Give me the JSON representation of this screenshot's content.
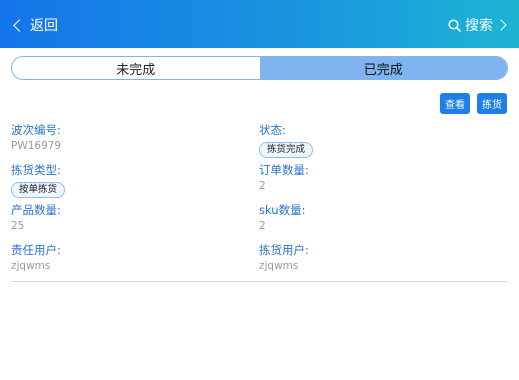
{
  "header": {
    "back_label": "返回",
    "search_label": "搜索"
  },
  "tabs": [
    {
      "label": "未完成",
      "active": false
    },
    {
      "label": "已完成",
      "active": true
    }
  ],
  "actions": {
    "view_label": "查看",
    "pick_label": "拣货"
  },
  "record": {
    "wave_no": {
      "label": "波次编号:",
      "value": "PW16979"
    },
    "status": {
      "label": "状态:",
      "value": "拣货完成"
    },
    "pick_type": {
      "label": "拣货类型:",
      "value": "按单拣货"
    },
    "order_count": {
      "label": "订单数量:",
      "value": "2"
    },
    "product_count": {
      "label": "产品数量:",
      "value": "25"
    },
    "sku_count": {
      "label": "sku数量:",
      "value": "2"
    },
    "responsible_user": {
      "label": "责任用户:",
      "value": "zjqwms"
    },
    "picking_user": {
      "label": "拣货用户:",
      "value": "zjqwms"
    }
  },
  "colors": {
    "header_start": "#1475ea",
    "header_end": "#1db4d4",
    "accent": "#1e7fe6",
    "label_blue": "#2a73c8"
  }
}
